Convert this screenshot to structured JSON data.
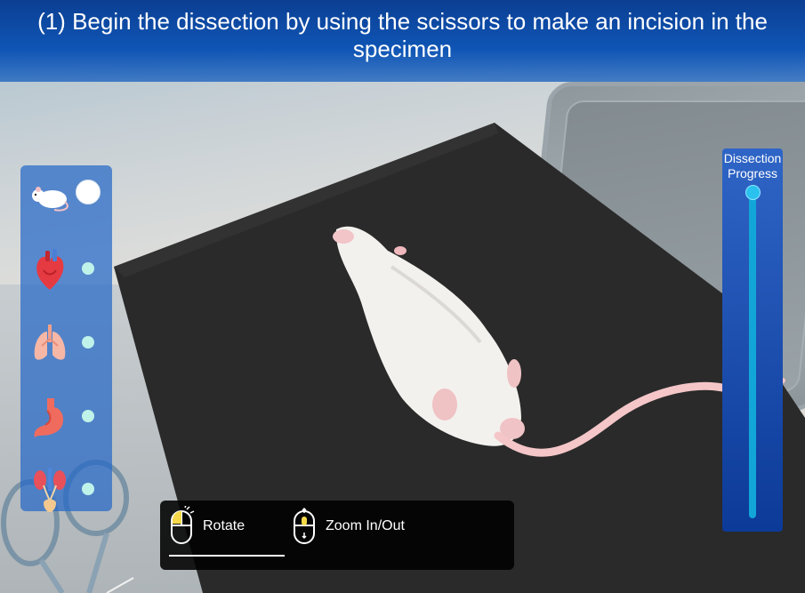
{
  "instruction": {
    "text": "(1) Begin the dissection by using the scissors to make an incision in the specimen"
  },
  "organ_panel": {
    "items": [
      {
        "id": "specimen",
        "icon": "rat-icon",
        "status": "active"
      },
      {
        "id": "heart",
        "icon": "heart-icon",
        "status": "pending"
      },
      {
        "id": "lungs",
        "icon": "lungs-icon",
        "status": "pending"
      },
      {
        "id": "stomach",
        "icon": "stomach-icon",
        "status": "pending"
      },
      {
        "id": "kidneys",
        "icon": "kidneys-icon",
        "status": "pending"
      }
    ]
  },
  "progress": {
    "title": "Dissection Progress",
    "value": 0
  },
  "controls": {
    "rotate_label": "Rotate",
    "zoom_label": "Zoom In/Out"
  },
  "colors": {
    "header": "#0f55b5",
    "panel": "#2668c8",
    "progress_track": "#12a6d8",
    "dot_active": "#ffffff",
    "dot_pending": "#bff3ea",
    "mat": "#2a2a2a"
  }
}
